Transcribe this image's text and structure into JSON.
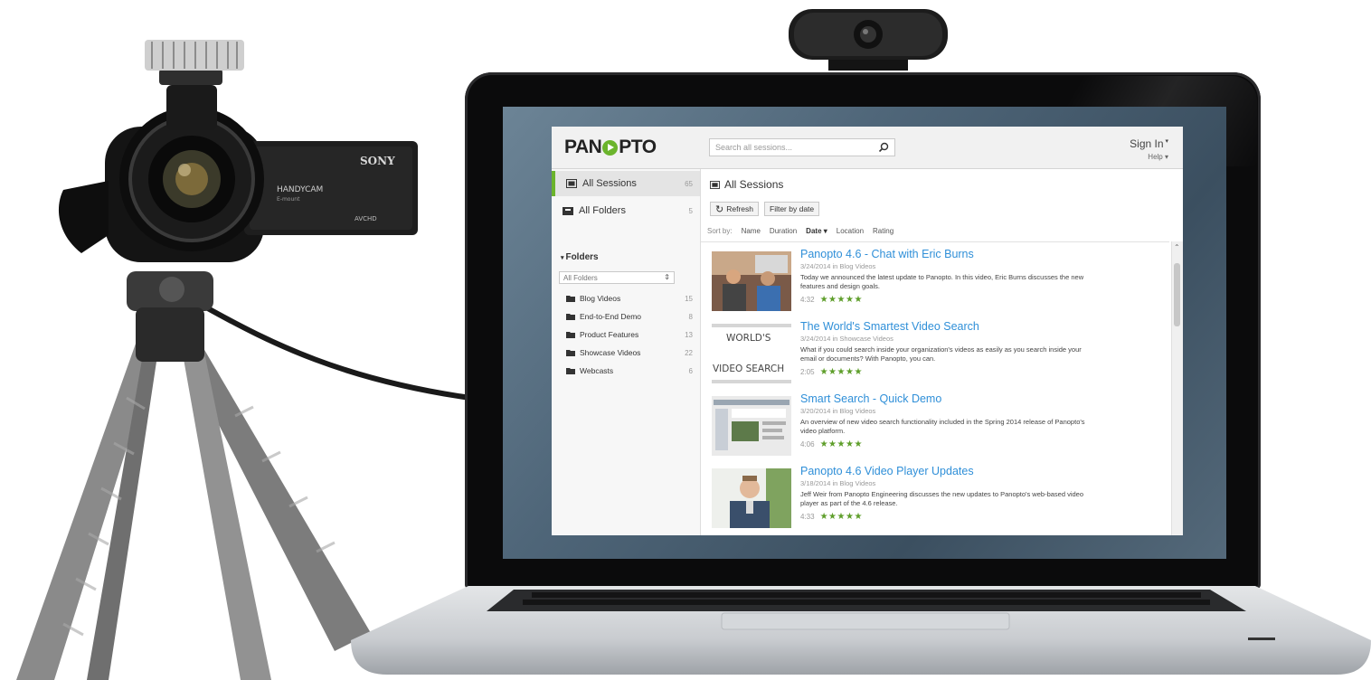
{
  "camcorder": {
    "brand": "SONY",
    "model": "HANDYCAM",
    "mount": "E-mount",
    "format": "AVCHD"
  },
  "app": {
    "logo": {
      "left": "PAN",
      "right": "PTO"
    },
    "search": {
      "placeholder": "Search all sessions..."
    },
    "account": {
      "sign_in": "Sign In",
      "help": "Help"
    },
    "sidebar": {
      "nav": [
        {
          "label": "All Sessions",
          "count": "65",
          "active": true
        },
        {
          "label": "All Folders",
          "count": "5",
          "active": false
        }
      ],
      "folders_heading": "Folders",
      "folder_filter": "All Folders",
      "folders": [
        {
          "label": "Blog Videos",
          "count": "15"
        },
        {
          "label": "End-to-End Demo",
          "count": "8"
        },
        {
          "label": "Product Features",
          "count": "13"
        },
        {
          "label": "Showcase Videos",
          "count": "22"
        },
        {
          "label": "Webcasts",
          "count": "6"
        }
      ]
    },
    "main": {
      "title": "All Sessions",
      "refresh_label": "Refresh",
      "filter_label": "Filter by date",
      "sort": {
        "label": "Sort by:",
        "options": [
          "Name",
          "Duration",
          "Date",
          "Location",
          "Rating"
        ],
        "active": "Date"
      },
      "sessions": [
        {
          "title": "Panopto 4.6 - Chat with Eric Burns",
          "date": "3/24/2014",
          "in_word": "in",
          "folder": "Blog Videos",
          "description": "Today we announced the latest update to Panopto. In this video, Eric Burns discusses the new features and design goals.",
          "duration": "4:32",
          "stars": "★★★★★"
        },
        {
          "title": "The World's Smartest Video Search",
          "date": "3/24/2014",
          "in_word": "in",
          "folder": "Showcase Videos",
          "description": "What if you could search inside your organization's videos as easily as you search inside your email or documents? With Panopto, you can.",
          "duration": "2:05",
          "stars": "★★★★★",
          "thumb_text_1": "WORLD'S",
          "thumb_text_2": "VIDEO SEARCH"
        },
        {
          "title": "Smart Search - Quick Demo",
          "date": "3/20/2014",
          "in_word": "in",
          "folder": "Blog Videos",
          "description": "An overview of new video search functionality included in the Spring 2014 release of Panopto's video platform.",
          "duration": "4:06",
          "stars": "★★★★★"
        },
        {
          "title": "Panopto 4.6 Video Player Updates",
          "date": "3/18/2014",
          "in_word": "in",
          "folder": "Blog Videos",
          "description": "Jeff Weir from Panopto Engineering discusses the new updates to Panopto's web-based video player as part of the 4.6 release.",
          "duration": "4:33",
          "stars": "★★★★★"
        }
      ]
    },
    "colors": {
      "accent_green": "#6bb42c",
      "link_blue": "#2f8fd8",
      "star_green": "#5e9e2a"
    }
  }
}
